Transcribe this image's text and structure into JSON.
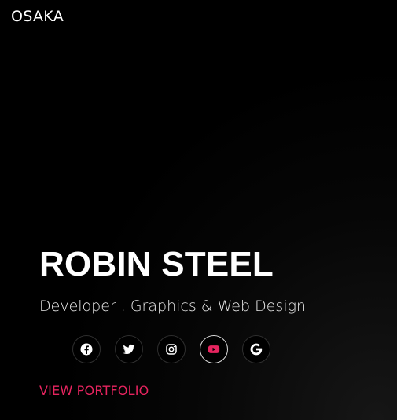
{
  "header": {
    "brand": "OSAKA"
  },
  "hero": {
    "name": "ROBIN STEEL",
    "role": "Developer , Graphics & Web Design",
    "cta_label": "VIEW PORTFOLIO"
  },
  "social_icons": [
    "facebook-icon",
    "twitter-icon",
    "instagram-icon",
    "youtube-icon",
    "google-icon"
  ],
  "colors": {
    "accent": "#e6245f",
    "background": "#000000",
    "text": "#ffffff"
  }
}
